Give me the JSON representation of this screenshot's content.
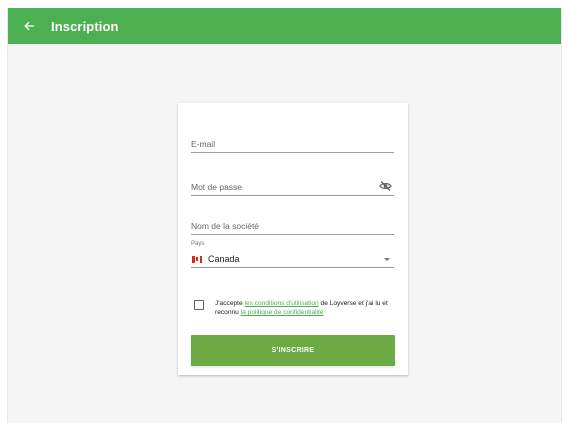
{
  "app_bar": {
    "title": "Inscription",
    "back_icon": "arrow-left-icon",
    "color": "#4caf50"
  },
  "form": {
    "email": {
      "placeholder": "E-mail",
      "value": ""
    },
    "password": {
      "placeholder": "Mot de passe",
      "value": "",
      "toggle_icon": "eye-off-icon"
    },
    "company": {
      "placeholder": "Nom de la société",
      "value": ""
    },
    "country": {
      "label": "Pays",
      "value": "Canada",
      "flag_icon": "canada-flag-icon",
      "dropdown_icon": "caret-down-icon"
    },
    "terms": {
      "checked": false,
      "text_before": "J'accepte",
      "link_terms": "les conditions d'utilisation",
      "text_middle": "de Loyverse et j'ai lu et reconnu",
      "link_privacy": "la politique de confidentialité",
      "link_color": "#4caf50"
    },
    "submit_label": "S'INSCRIRE",
    "submit_color": "#6cab43"
  }
}
